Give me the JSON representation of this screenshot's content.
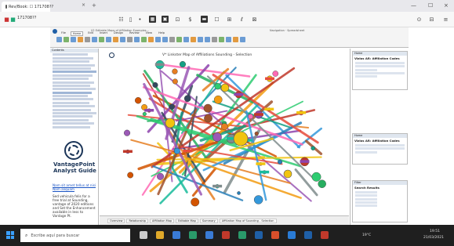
{
  "browser": {
    "tab_title": "Rev/Book: ☐ 171708??",
    "address": "171708??",
    "tab_close": "×",
    "new_tab": "+",
    "win_min": "—",
    "win_max": "☐",
    "win_close": "×"
  },
  "app": {
    "ribbon_title": "V2 Editable Maps of Affiliation Examples...",
    "ribbon_right": "Navigation · Spreadsheet",
    "tabs": [
      "File",
      "Home",
      "Edit",
      "Insert",
      "Design",
      "Review",
      "View",
      "Help"
    ],
    "canvas_title": "V* Linkster Map of Affiliations Sounding - Selection",
    "sheet_tabs": [
      "Overview",
      "Relationship",
      "Affiliation Map",
      "Editable Map",
      "Summary",
      "Affiliation Map of Sounding - Selection"
    ],
    "left_panel": {
      "header": "Contents",
      "logo_title_line1": "VantagePoint",
      "logo_title_line2": "Analyst Guide",
      "link_text": "Nam sit amet tellus at nisi Nam aliquam",
      "body_text": "Sed vehicula felis for a free trial at Sounding, vantage of 2020 editions and Set the Enhancement available in less to Vantage Pt."
    },
    "right_panel": {
      "box1_head": "Home",
      "box1_title": "Vizios AR: Affiliation Codes",
      "box2_head": "Home",
      "box2_title": "Vizios AR: Affiliation Codes",
      "box3_head": "Filter",
      "box3_title": "Search Results"
    }
  },
  "taskbar": {
    "search_placeholder": "Escribe aquí para buscar",
    "weather": "19°C",
    "time": "19:51",
    "date": "21/03/2021"
  },
  "colors": {
    "taskbar": "#1f1f1f",
    "windows_blue": "#3aa0ff",
    "accent": "#1b3558"
  }
}
